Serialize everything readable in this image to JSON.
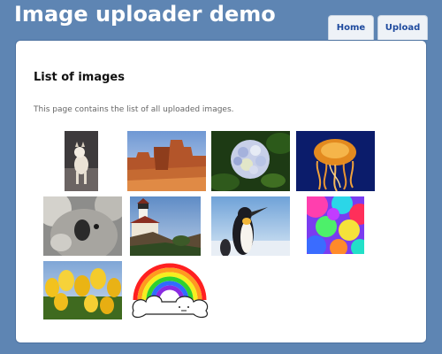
{
  "header": {
    "title": "Image uploader demo"
  },
  "nav": {
    "tabs": [
      {
        "label": "Home"
      },
      {
        "label": "Upload"
      }
    ]
  },
  "main": {
    "heading": "List of images",
    "description": "This page contains the list of all uploaded images."
  },
  "colors": {
    "page_background": "#5e85b3",
    "panel_background": "#ffffff",
    "tab_text": "#1e4a9e"
  }
}
